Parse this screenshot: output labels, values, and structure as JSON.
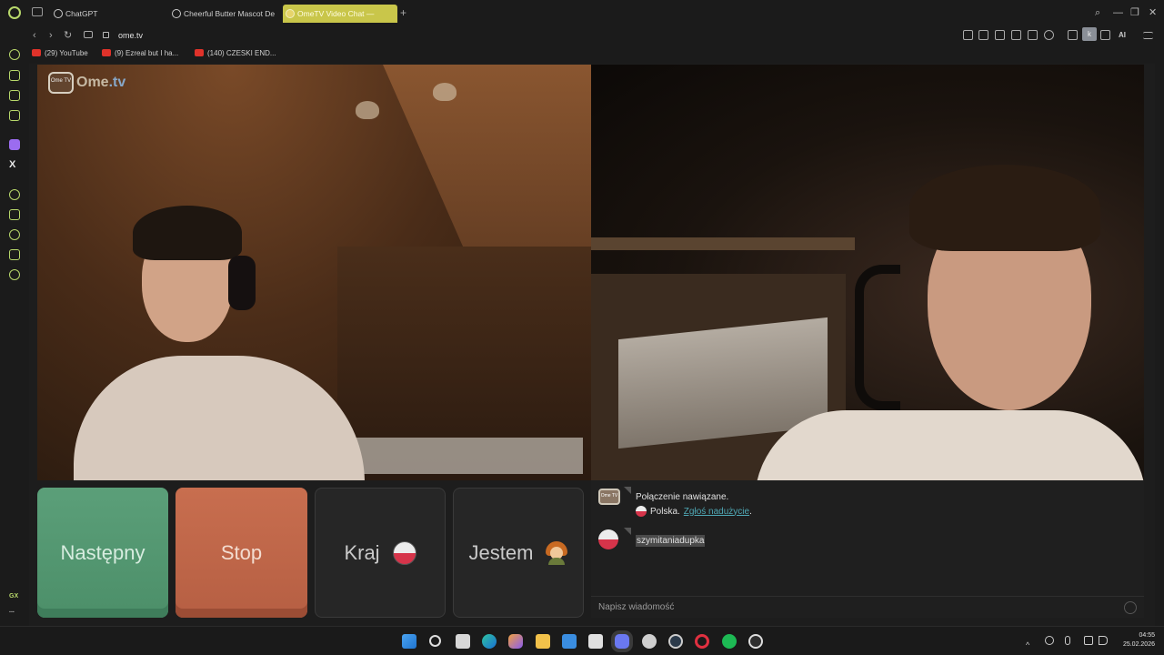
{
  "browser": {
    "tabs": [
      {
        "label": "ChatGPT"
      },
      {
        "label": "Cheerful Butter Mascot De"
      },
      {
        "label": "OmeTV Video Chat —",
        "active": true
      }
    ],
    "url": "ome.tv",
    "ai_label": "AI",
    "ext_label": "k",
    "bookmarks": [
      {
        "label": "(29) YouTube"
      },
      {
        "label": "(9) Ezreal but I ha..."
      },
      {
        "label": "(140) CZESKI END..."
      }
    ],
    "sidebar_gx_label": "GX",
    "sidebar_more_label": "..."
  },
  "ome": {
    "logo_main": "Ome",
    "logo_tv": ".tv",
    "logo_icon_text": "Ome TV",
    "buttons": {
      "next_label": "Następny",
      "stop_label": "Stop",
      "country_label": "Kraj",
      "gender_label": "Jestem"
    },
    "chat": {
      "system_message": "Połączenie nawiązane.",
      "country_text": "Polska.",
      "report_link": "Zgłoś nadużycie",
      "report_suffix": ".",
      "user_message": "szymitaniadupka",
      "input_placeholder": "Napisz wiadomość"
    }
  },
  "taskbar": {
    "time": "04:55",
    "date": "25.02.2026"
  },
  "colors": {
    "next_button": "#4c8f69",
    "stop_button": "#b65f43",
    "active_tab": "#c9c64a",
    "sidebar_accent": "#b8d86b",
    "report_link": "#4fa8b5"
  }
}
